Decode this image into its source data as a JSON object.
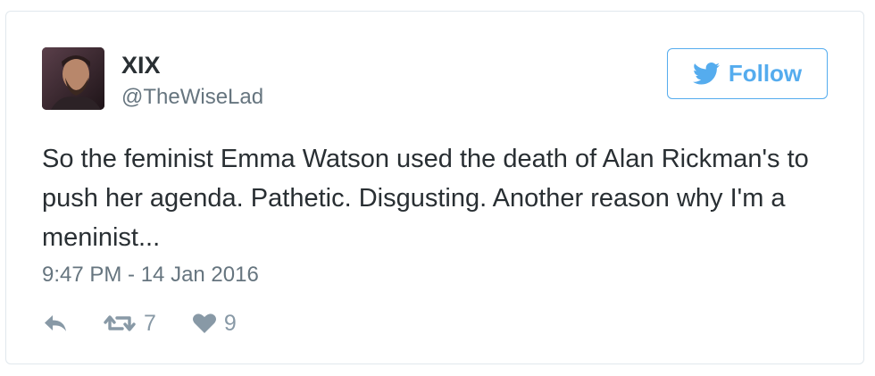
{
  "tweet": {
    "display_name": "XIX",
    "handle": "@TheWiseLad",
    "text": "So the feminist Emma Watson used the death of Alan Rickman's to push her agenda. Pathetic. Disgusting. Another reason why I'm a meninist...",
    "timestamp": "9:47 PM - 14 Jan 2016",
    "avatar_icon": "user-avatar-photo"
  },
  "follow_button": {
    "label": "Follow",
    "icon": "twitter-bird-icon",
    "color": "#55acee"
  },
  "actions": {
    "reply_icon": "reply-icon",
    "retweet_icon": "retweet-icon",
    "retweet_count": "7",
    "like_icon": "heart-icon",
    "like_count": "9"
  },
  "colors": {
    "text": "#292f33",
    "secondary": "#66757f",
    "action": "#8899a6",
    "border": "#e1e8ed"
  }
}
